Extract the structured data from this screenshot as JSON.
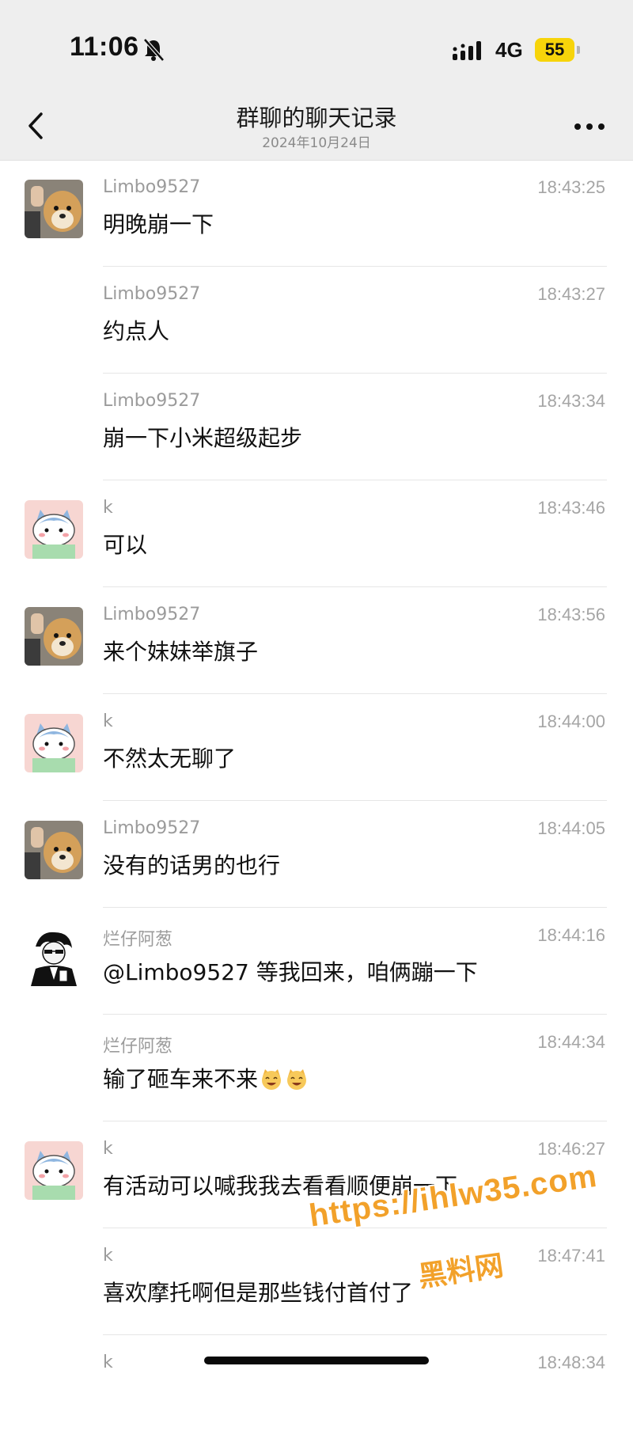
{
  "status": {
    "time": "11:06",
    "network": "4G",
    "battery": "55"
  },
  "nav": {
    "title": "群聊的聊天记录",
    "subtitle": "2024年10月24日"
  },
  "messages": [
    {
      "sender": "Limbo9527",
      "time": "18:43:25",
      "text": "明晚崩一下",
      "avatar": "shiba-avatar"
    },
    {
      "sender": "Limbo9527",
      "time": "18:43:27",
      "text": "约点人",
      "avatar": ""
    },
    {
      "sender": "Limbo9527",
      "time": "18:43:34",
      "text": "崩一下小米超级起步",
      "avatar": ""
    },
    {
      "sender": "k",
      "time": "18:43:46",
      "text": "可以",
      "avatar": "cat-avatar"
    },
    {
      "sender": "Limbo9527",
      "time": "18:43:56",
      "text": "来个妹妹举旗子",
      "avatar": "shiba-avatar"
    },
    {
      "sender": "k",
      "time": "18:44:00",
      "text": "不然太无聊了",
      "avatar": "cat-avatar"
    },
    {
      "sender": "Limbo9527",
      "time": "18:44:05",
      "text": "没有的话男的也行",
      "avatar": "shiba-avatar"
    },
    {
      "sender": "烂仔阿葱",
      "time": "18:44:16",
      "text": "@Limbo9527 等我回来，咱俩蹦一下",
      "avatar": "suit-avatar"
    },
    {
      "sender": "烂仔阿葱",
      "time": "18:44:34",
      "text": "输了砸车来不来",
      "avatar": ""
    },
    {
      "sender": "k",
      "time": "18:46:27",
      "text": "有活动可以喊我我去看看顺便崩一下",
      "avatar": "cat-avatar"
    },
    {
      "sender": "k",
      "time": "18:47:41",
      "text": "喜欢摩托啊但是那些钱付首付了",
      "avatar": ""
    },
    {
      "sender": "k",
      "time": "18:48:34",
      "text": "",
      "avatar": ""
    }
  ],
  "watermark": {
    "url": "https://ihlw35.com",
    "name": "黑料网"
  }
}
